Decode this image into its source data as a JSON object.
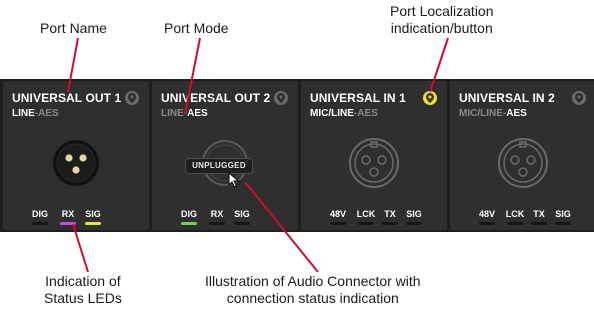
{
  "callouts": {
    "port_name": "Port Name",
    "port_mode": "Port Mode",
    "port_localization_line1": "Port Localization",
    "port_localization_line2": "indication/button",
    "status_leds_line1": "Indication of",
    "status_leds_line2": "Status LEDs",
    "connector_line1": "Illustration of Audio Connector with",
    "connector_line2": "connection status indication"
  },
  "colors": {
    "panel_bg": "#2f2f2f",
    "strip_bg": "#1e1e1e",
    "led_off": "#161616",
    "led_magenta": "#c04fe0",
    "led_yellow": "#e8e63a",
    "led_green": "#6fd14a",
    "locate_active": "#f5e02b",
    "locate_inactive": "#6b6b6b"
  },
  "ports": [
    {
      "name": "UNIVERSAL OUT 1",
      "mode_a": "LINE",
      "mode_sep": "-",
      "mode_b": "AES",
      "active_mode": "a",
      "connector": "xlr-male",
      "connector_icon": "xlr-male-connector-icon",
      "locate_active": false,
      "unplugged": false,
      "leds": [
        {
          "label": "DIG",
          "state": "off"
        },
        {
          "label": "RX",
          "state": "magenta"
        },
        {
          "label": "SIG",
          "state": "yellow"
        }
      ]
    },
    {
      "name": "UNIVERSAL OUT 2",
      "mode_a": "LINE",
      "mode_sep": "-",
      "mode_b": "AES",
      "active_mode": "b",
      "connector": "empty",
      "connector_icon": "empty-socket-icon",
      "locate_active": false,
      "unplugged": true,
      "unplugged_label": "UNPLUGGED",
      "leds": [
        {
          "label": "DIG",
          "state": "green"
        },
        {
          "label": "RX",
          "state": "off"
        },
        {
          "label": "SIG",
          "state": "off"
        }
      ]
    },
    {
      "name": "UNIVERSAL IN 1",
      "mode_a": "MIC/LINE",
      "mode_sep": "-",
      "mode_b": "AES",
      "active_mode": "a",
      "connector": "xlr-female",
      "connector_icon": "xlr-female-connector-icon",
      "locate_active": true,
      "unplugged": false,
      "leds": [
        {
          "label": "48V",
          "state": "off"
        },
        {
          "label": "LCK",
          "state": "off"
        },
        {
          "label": "TX",
          "state": "off"
        },
        {
          "label": "SIG",
          "state": "off"
        }
      ]
    },
    {
      "name": "UNIVERSAL IN 2",
      "mode_a": "MIC/LINE",
      "mode_sep": "-",
      "mode_b": "AES",
      "active_mode": "b",
      "connector": "xlr-female",
      "connector_icon": "xlr-female-connector-icon",
      "locate_active": false,
      "unplugged": false,
      "leds": [
        {
          "label": "48V",
          "state": "off"
        },
        {
          "label": "LCK",
          "state": "off"
        },
        {
          "label": "TX",
          "state": "off"
        },
        {
          "label": "SIG",
          "state": "off"
        }
      ]
    }
  ]
}
